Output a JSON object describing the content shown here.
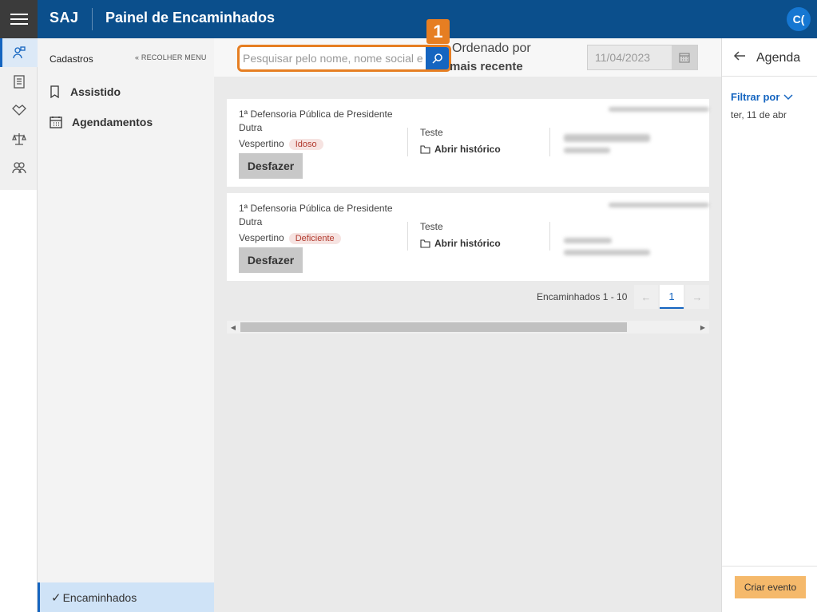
{
  "header": {
    "brand": "SAJ",
    "title": "Painel de Encaminhados",
    "avatar_initials": "C("
  },
  "rail": {
    "items": [
      "assisted-person-icon",
      "clipboard-icon",
      "handshake-icon",
      "scales-icon",
      "group-icon"
    ],
    "active_index": 0
  },
  "sidemenu": {
    "title": "Cadastros",
    "collapse_label": "RECOLHER MENU",
    "items": [
      {
        "label": "Assistido",
        "icon": "bookmark-icon"
      },
      {
        "label": "Agendamentos",
        "icon": "calendar-icon"
      }
    ],
    "bottom_label": "Encaminhados"
  },
  "toolbar": {
    "search_placeholder": "Pesquisar pelo nome, nome social e",
    "badge": "1",
    "order_label": "Ordenado por",
    "order_value": "mais recente",
    "date_value": "11/04/2023"
  },
  "cards": [
    {
      "office_line1": "1ª Defensoria Pública de Presidente",
      "office_line2": "Dutra",
      "shift": "Vespertino",
      "tag": "Idoso",
      "undo_label": "Desfazer",
      "subject": "Teste",
      "history_label": "Abrir histórico"
    },
    {
      "office_line1": "1ª Defensoria Pública de Presidente",
      "office_line2": "Dutra",
      "shift": "Vespertino",
      "tag": "Deficiente",
      "undo_label": "Desfazer",
      "subject": "Teste",
      "history_label": "Abrir histórico"
    }
  ],
  "pagination": {
    "label": "Encaminhados 1 - 10",
    "current_page": "1",
    "prev": "←",
    "next": "→"
  },
  "agenda": {
    "title": "Agenda",
    "filter_label": "Filtrar por",
    "date_label": "ter, 11 de abr",
    "create_label": "Criar evento"
  },
  "colors": {
    "header": "#0b4f8c",
    "accent": "#1565c0",
    "highlight": "#e67e22",
    "create_button": "#f5b96b"
  }
}
